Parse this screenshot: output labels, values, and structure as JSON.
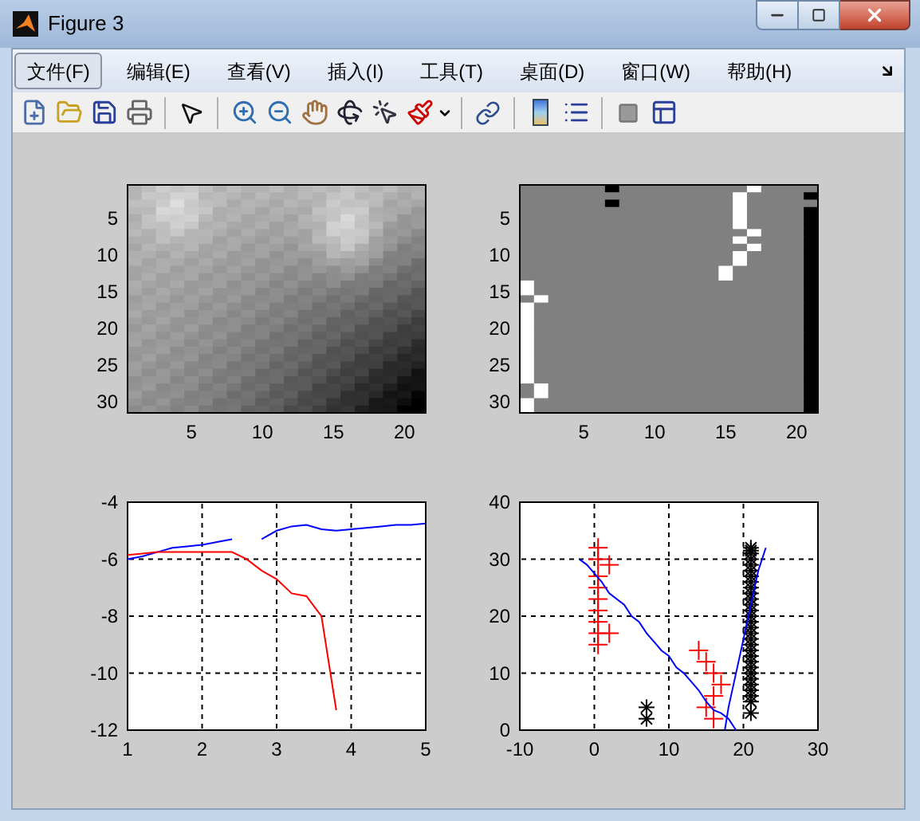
{
  "window": {
    "title": "Figure 3"
  },
  "menu": [
    {
      "label": "文件(F)",
      "selected": true
    },
    {
      "label": "编辑(E)",
      "selected": false
    },
    {
      "label": "查看(V)",
      "selected": false
    },
    {
      "label": "插入(I)",
      "selected": false
    },
    {
      "label": "工具(T)",
      "selected": false
    },
    {
      "label": "桌面(D)",
      "selected": false
    },
    {
      "label": "窗口(W)",
      "selected": false
    },
    {
      "label": "帮助(H)",
      "selected": false
    }
  ],
  "subplots": [
    {
      "kind": "grayscale",
      "xticks": [
        "5",
        "10",
        "15",
        "20"
      ],
      "yticks": [
        "5",
        "10",
        "15",
        "20",
        "25",
        "30"
      ]
    },
    {
      "kind": "binary",
      "xticks": [
        "5",
        "10",
        "15",
        "20"
      ],
      "yticks": [
        "5",
        "10",
        "15",
        "20",
        "25",
        "30"
      ]
    },
    {
      "kind": "chart",
      "chart_data": {
        "type": "line",
        "grid": true,
        "xlim": [
          1,
          5
        ],
        "ylim": [
          -12,
          -4
        ],
        "xticks": [
          1,
          2,
          3,
          4,
          5
        ],
        "yticks": [
          -12,
          -10,
          -8,
          -6,
          -4
        ],
        "x": [
          1,
          1.2,
          1.4,
          1.6,
          1.8,
          2,
          2.2,
          2.4,
          2.6,
          2.8,
          3,
          3.2,
          3.4,
          3.6,
          3.8,
          4,
          4.2,
          4.4,
          4.6,
          4.8,
          5
        ],
        "series": [
          {
            "color": "#0000ff",
            "values": [
              -6.0,
              -5.9,
              -5.75,
              -5.6,
              -5.55,
              -5.5,
              -5.4,
              -5.3,
              null,
              -5.3,
              -5.0,
              -4.85,
              -4.8,
              -4.95,
              -5.0,
              -4.95,
              -4.9,
              -4.85,
              -4.8,
              -4.8,
              -4.75
            ]
          },
          {
            "color": "#ff0000",
            "values": [
              -5.85,
              -5.8,
              -5.75,
              -5.75,
              -5.75,
              -5.75,
              -5.75,
              -5.75,
              -6.0,
              -6.4,
              -6.7,
              -7.2,
              -7.3,
              -8.0,
              -11.3,
              null,
              null,
              null,
              null,
              null,
              null
            ]
          }
        ]
      }
    },
    {
      "kind": "chart",
      "chart_data": {
        "type": "scatter",
        "grid": true,
        "xlim": [
          -10,
          30
        ],
        "ylim": [
          0,
          40
        ],
        "xticks": [
          -10,
          0,
          10,
          20,
          30
        ],
        "yticks": [
          0,
          10,
          20,
          30,
          40
        ],
        "series": [
          {
            "marker": "cross",
            "color": "#ff0000",
            "x": [
              0.5,
              0.5,
              2,
              0.5,
              0.5,
              0.5,
              0.5,
              0.5,
              0.5,
              2,
              0.5,
              14,
              15,
              16,
              17,
              16,
              15,
              16
            ],
            "values": [
              32,
              30,
              29,
              27,
              25,
              23,
              21,
              19,
              17,
              17,
              15,
              14,
              12,
              10,
              8,
              6,
              4,
              2
            ]
          },
          {
            "color": "#000000",
            "x": [
              7,
              7,
              21,
              21,
              21,
              21,
              21,
              21,
              21,
              21,
              21,
              21,
              21,
              21,
              21,
              21,
              21,
              21,
              21,
              21,
              21,
              21,
              21,
              21,
              21,
              21,
              21,
              21,
              21,
              21,
              21,
              21
            ],
            "values": [
              2,
              4,
              3,
              5,
              6,
              7,
              8,
              9,
              10,
              11,
              12,
              13,
              14,
              15,
              16,
              17,
              18,
              19,
              20,
              21,
              22,
              23,
              24,
              25,
              26,
              27,
              28,
              29,
              30,
              31,
              32,
              31.5
            ]
          },
          {
            "type": "line",
            "color": "#0000ff",
            "x": [
              -2,
              -1,
              0,
              1,
              2,
              4,
              5,
              6,
              7,
              8,
              9,
              10,
              11,
              12,
              13,
              14,
              15,
              16,
              17,
              18,
              19,
              null,
              17.5,
              18,
              19,
              20,
              21,
              22,
              23
            ],
            "values": [
              30,
              29,
              27.5,
              26,
              24,
              22,
              20,
              19,
              17,
              15.5,
              14,
              13,
              11,
              10,
              8.5,
              7,
              5,
              3.5,
              3,
              2,
              0,
              null,
              0,
              4,
              10,
              16,
              22,
              28,
              32
            ]
          }
        ]
      }
    }
  ]
}
